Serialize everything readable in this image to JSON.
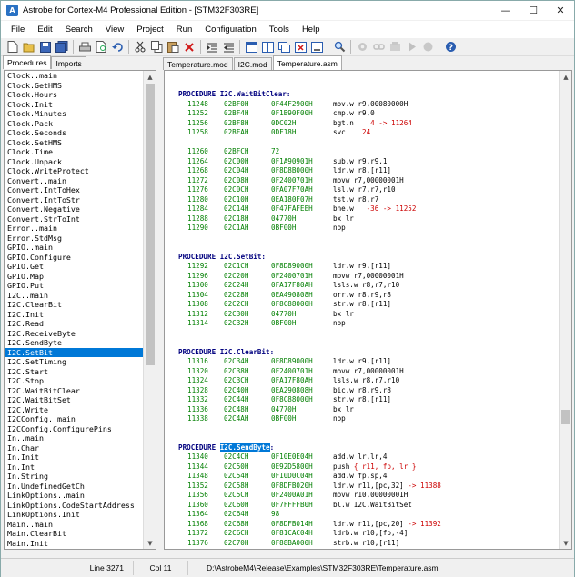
{
  "window": {
    "title": "Astrobe for Cortex-M4 Professional Edition - [STM32F303RE]"
  },
  "window_controls": {
    "minimize": "—",
    "maximize": "☐",
    "close": "✕"
  },
  "menu": [
    "File",
    "Edit",
    "Search",
    "View",
    "Project",
    "Run",
    "Configuration",
    "Tools",
    "Help"
  ],
  "toolbar_icons": [
    "new-file-icon",
    "open-folder-icon",
    "save-icon",
    "save-all-icon",
    "print-icon",
    "print-preview-icon",
    "undo-icon",
    "cut-icon",
    "copy-icon",
    "paste-icon",
    "delete-icon",
    "indent-icon",
    "outdent-icon",
    "window-icon",
    "window-tile-icon",
    "window-cascade-icon",
    "close-window-icon",
    "minimize-window-icon",
    "find-icon",
    "compile-icon",
    "link-icon",
    "build-icon",
    "run-icon",
    "stop-icon",
    "help-icon"
  ],
  "left_panel": {
    "tabs": [
      "Procedures",
      "Imports"
    ],
    "selected_index": 29,
    "items": [
      "Clock..main",
      "Clock.GetHMS",
      "Clock.Hours",
      "Clock.Init",
      "Clock.Minutes",
      "Clock.Pack",
      "Clock.Seconds",
      "Clock.SetHMS",
      "Clock.Time",
      "Clock.Unpack",
      "Clock.WriteProtect",
      "Convert..main",
      "Convert.IntToHex",
      "Convert.IntToStr",
      "Convert.Negative",
      "Convert.StrToInt",
      "Error..main",
      "Error.StdMsg",
      "GPIO..main",
      "GPIO.Configure",
      "GPIO.Get",
      "GPIO.Map",
      "GPIO.Put",
      "I2C..main",
      "I2C.ClearBit",
      "I2C.Init",
      "I2C.Read",
      "I2C.ReceiveByte",
      "I2C.SendByte",
      "I2C.SetBit",
      "I2C.SetTiming",
      "I2C.Start",
      "I2C.Stop",
      "I2C.WaitBitClear",
      "I2C.WaitBitSet",
      "I2C.Write",
      "I2CConfig..main",
      "I2CConfig.ConfigurePins",
      "In..main",
      "In.Char",
      "In.Init",
      "In.Int",
      "In.String",
      "In.UndefinedGetCh",
      "LinkOptions..main",
      "LinkOptions.CodeStartAddress",
      "LinkOptions.Init",
      "Main..main",
      "Main.ClearBit",
      "Main.Init"
    ]
  },
  "editor": {
    "tabs": [
      "Temperature.mod",
      "I2C.mod",
      "Temperature.asm"
    ],
    "active_tab": 2,
    "lines": [
      {
        "t": "blank"
      },
      {
        "t": "blank"
      },
      {
        "t": "proc",
        "name": "I2C.WaitBitClear:"
      },
      {
        "t": "code",
        "ln": "11248",
        "addr": "02BF0H",
        "hex": "0F44F2900H",
        "instr": "mov.w r9,00080000H",
        "tgt": ""
      },
      {
        "t": "code",
        "ln": "11252",
        "addr": "02BF4H",
        "hex": "0F1B90F00H",
        "instr": "cmp.w r9,0",
        "tgt": ""
      },
      {
        "t": "code",
        "ln": "11256",
        "addr": "02BF8H",
        "hex": "0DC02H",
        "instr": "bgt.n    ",
        "tgt": "4 -> 11264"
      },
      {
        "t": "code",
        "ln": "11258",
        "addr": "02BFAH",
        "hex": "0DF18H",
        "instr": "svc    ",
        "tgt": "24"
      },
      {
        "t": "blank"
      },
      {
        "t": "code",
        "ln": "11260",
        "addr": "02BFCH",
        "hex": "72",
        "instr": "",
        "tgt": ""
      },
      {
        "t": "code",
        "ln": "11264",
        "addr": "02C00H",
        "hex": "0F1A90901H",
        "instr": "sub.w r9,r9,1",
        "tgt": ""
      },
      {
        "t": "code",
        "ln": "11268",
        "addr": "02C04H",
        "hex": "0F8D8B000H",
        "instr": "ldr.w r8,[r11]",
        "tgt": ""
      },
      {
        "t": "code",
        "ln": "11272",
        "addr": "02C08H",
        "hex": "0F2400701H",
        "instr": "movw r7,00000001H",
        "tgt": ""
      },
      {
        "t": "code",
        "ln": "11276",
        "addr": "02C0CH",
        "hex": "0FA07F70AH",
        "instr": "lsl.w r7,r7,r10",
        "tgt": ""
      },
      {
        "t": "code",
        "ln": "11280",
        "addr": "02C10H",
        "hex": "0EA180F07H",
        "instr": "tst.w r8,r7",
        "tgt": ""
      },
      {
        "t": "code",
        "ln": "11284",
        "addr": "02C14H",
        "hex": "0F47FAFEEH",
        "instr": "bne.w   ",
        "tgt": "-36 -> 11252"
      },
      {
        "t": "code",
        "ln": "11288",
        "addr": "02C18H",
        "hex": "04770H",
        "instr": "bx lr",
        "tgt": ""
      },
      {
        "t": "code",
        "ln": "11290",
        "addr": "02C1AH",
        "hex": "0BF00H",
        "instr": "nop",
        "tgt": ""
      },
      {
        "t": "blank"
      },
      {
        "t": "blank"
      },
      {
        "t": "proc",
        "name": "I2C.SetBit:"
      },
      {
        "t": "code",
        "ln": "11292",
        "addr": "02C1CH",
        "hex": "0F8D89000H",
        "instr": "ldr.w r9,[r11]",
        "tgt": ""
      },
      {
        "t": "code",
        "ln": "11296",
        "addr": "02C20H",
        "hex": "0F2400701H",
        "instr": "movw r7,00000001H",
        "tgt": ""
      },
      {
        "t": "code",
        "ln": "11300",
        "addr": "02C24H",
        "hex": "0FA17F80AH",
        "instr": "lsls.w r8,r7,r10",
        "tgt": ""
      },
      {
        "t": "code",
        "ln": "11304",
        "addr": "02C28H",
        "hex": "0EA490808H",
        "instr": "orr.w r8,r9,r8",
        "tgt": ""
      },
      {
        "t": "code",
        "ln": "11308",
        "addr": "02C2CH",
        "hex": "0F8C88000H",
        "instr": "str.w r8,[r11]",
        "tgt": ""
      },
      {
        "t": "code",
        "ln": "11312",
        "addr": "02C30H",
        "hex": "04770H",
        "instr": "bx lr",
        "tgt": ""
      },
      {
        "t": "code",
        "ln": "11314",
        "addr": "02C32H",
        "hex": "0BF00H",
        "instr": "nop",
        "tgt": ""
      },
      {
        "t": "blank"
      },
      {
        "t": "blank"
      },
      {
        "t": "proc",
        "name": "I2C.ClearBit:"
      },
      {
        "t": "code",
        "ln": "11316",
        "addr": "02C34H",
        "hex": "0F8D89000H",
        "instr": "ldr.w r9,[r11]",
        "tgt": ""
      },
      {
        "t": "code",
        "ln": "11320",
        "addr": "02C38H",
        "hex": "0F2400701H",
        "instr": "movw r7,00000001H",
        "tgt": ""
      },
      {
        "t": "code",
        "ln": "11324",
        "addr": "02C3CH",
        "hex": "0FA17F80AH",
        "instr": "lsls.w r8,r7,r10",
        "tgt": ""
      },
      {
        "t": "code",
        "ln": "11328",
        "addr": "02C40H",
        "hex": "0EA290808H",
        "instr": "bic.w r8,r9,r8",
        "tgt": ""
      },
      {
        "t": "code",
        "ln": "11332",
        "addr": "02C44H",
        "hex": "0F8C88000H",
        "instr": "str.w r8,[r11]",
        "tgt": ""
      },
      {
        "t": "code",
        "ln": "11336",
        "addr": "02C48H",
        "hex": "04770H",
        "instr": "bx lr",
        "tgt": ""
      },
      {
        "t": "code",
        "ln": "11338",
        "addr": "02C4AH",
        "hex": "0BF00H",
        "instr": "nop",
        "tgt": ""
      },
      {
        "t": "blank"
      },
      {
        "t": "blank"
      },
      {
        "t": "proc",
        "name": "I2C.SendByte",
        "suffix": ":",
        "hl": true
      },
      {
        "t": "code",
        "ln": "11340",
        "addr": "02C4CH",
        "hex": "0F10E0E04H",
        "instr": "add.w lr,lr,4",
        "tgt": ""
      },
      {
        "t": "code",
        "ln": "11344",
        "addr": "02C50H",
        "hex": "0E92D5800H",
        "instr": "push ",
        "tgt": "{ r11, fp, lr }"
      },
      {
        "t": "code",
        "ln": "11348",
        "addr": "02C54H",
        "hex": "0F10D0C04H",
        "instr": "add.w fp,sp,4",
        "tgt": ""
      },
      {
        "t": "code",
        "ln": "11352",
        "addr": "02C58H",
        "hex": "0F8DFB020H",
        "instr": "ldr.w r11,[pc,32] ",
        "tgt": "-> 11388"
      },
      {
        "t": "code",
        "ln": "11356",
        "addr": "02C5CH",
        "hex": "0F2400A01H",
        "instr": "movw r10,00000001H",
        "tgt": ""
      },
      {
        "t": "code",
        "ln": "11360",
        "addr": "02C60H",
        "hex": "0F7FFFFB0H",
        "instr": "bl.w I2C.WaitBitSet",
        "tgt": ""
      },
      {
        "t": "code",
        "ln": "11364",
        "addr": "02C64H",
        "hex": "98",
        "instr": "",
        "tgt": ""
      },
      {
        "t": "code",
        "ln": "11368",
        "addr": "02C68H",
        "hex": "0F8DFB014H",
        "instr": "ldr.w r11,[pc,20] ",
        "tgt": "-> 11392"
      },
      {
        "t": "code",
        "ln": "11372",
        "addr": "02C6CH",
        "hex": "0F81CAC04H",
        "instr": "ldrb.w r10,[fp,-4]",
        "tgt": ""
      },
      {
        "t": "code",
        "ln": "11376",
        "addr": "02C70H",
        "hex": "0F88BA000H",
        "instr": "strb.w r10,[r11]",
        "tgt": ""
      }
    ]
  },
  "status": {
    "line": "Line 3271",
    "col": "Col 11",
    "path": "D:\\AstrobeM4\\Release\\Examples\\STM32F303RE\\Temperature.asm"
  },
  "scroll_arrows": {
    "up": "▲",
    "down": "▼"
  }
}
